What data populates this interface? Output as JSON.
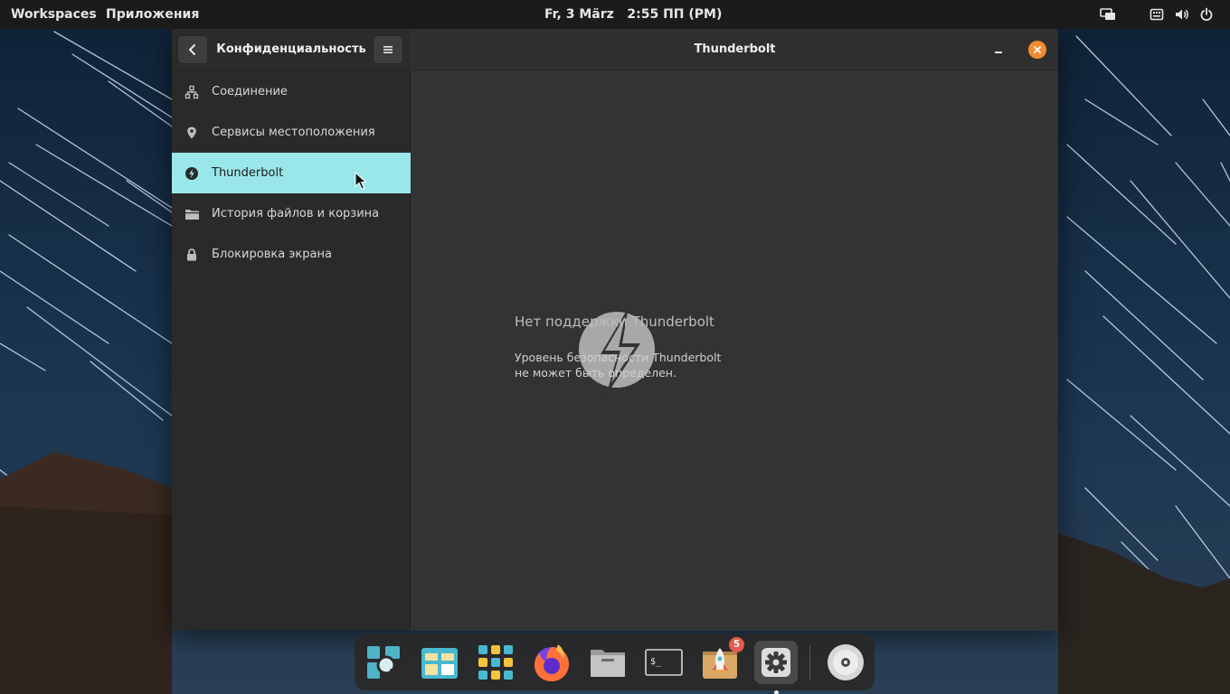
{
  "top_panel": {
    "workspaces": "Workspaces",
    "applications": "Приложения",
    "datetime": "Fr, 3 März   2:55 ПП (PM)",
    "tray_icons": [
      "display-icon",
      "keyboard-icon",
      "volume-icon",
      "power-icon"
    ]
  },
  "window": {
    "sidebar": {
      "title": "Конфиденциальность",
      "items": [
        {
          "label": "Соединение",
          "icon": "network-icon"
        },
        {
          "label": "Сервисы местоположения",
          "icon": "location-pin-icon"
        },
        {
          "label": "Thunderbolt",
          "icon": "thunderbolt-icon",
          "active": true
        },
        {
          "label": "История файлов и корзина",
          "icon": "folder-icon"
        },
        {
          "label": "Блокировка экрана",
          "icon": "lock-icon"
        }
      ]
    },
    "content": {
      "title": "Thunderbolt",
      "empty_title": "Нет поддержки Thunderbolt",
      "empty_desc_line1": "Уровень безопасности Thunderbolt",
      "empty_desc_line2": "не может быть определен."
    }
  },
  "dock": {
    "items": [
      {
        "name": "search-app",
        "icon": "magnifier-icon"
      },
      {
        "name": "files-app-1",
        "icon": "window-layout-icon"
      },
      {
        "name": "app-grid",
        "icon": "app-grid-icon"
      },
      {
        "name": "firefox",
        "icon": "firefox-icon"
      },
      {
        "name": "files-app-2",
        "icon": "folder-icon"
      },
      {
        "name": "terminal",
        "icon": "terminal-icon"
      },
      {
        "name": "store",
        "icon": "rocket-icon"
      },
      {
        "name": "settings",
        "icon": "gear-icon"
      },
      {
        "name": "disc",
        "icon": "disc-icon"
      }
    ],
    "store_badge": "5"
  },
  "colors": {
    "active_item": "#9ae7ea",
    "close_button": "#f08c2f",
    "badge": "#e25b4c"
  }
}
